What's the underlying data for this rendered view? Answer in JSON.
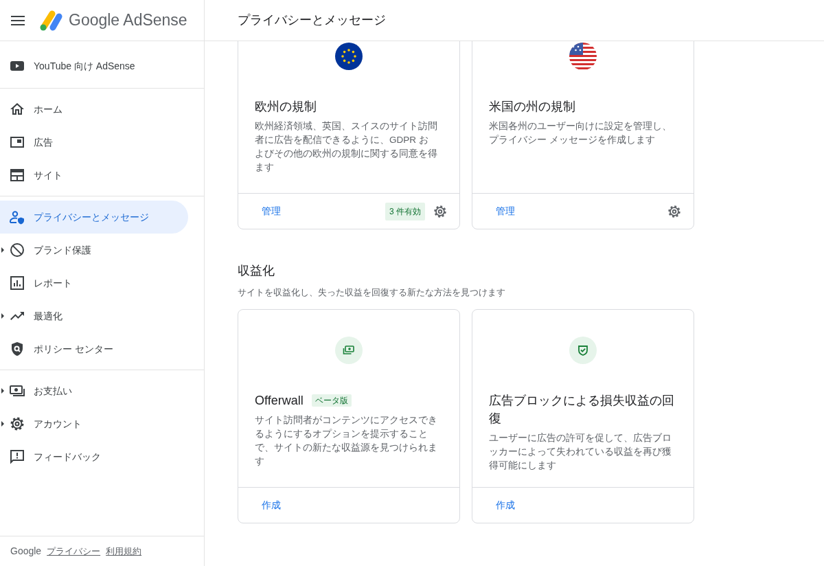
{
  "header": {
    "logo_text": "Google AdSense",
    "page_title": "プライバシーとメッセージ"
  },
  "sidebar": {
    "groups": [
      {
        "items": [
          {
            "label": "YouTube 向け AdSense",
            "selected": false,
            "expandable": false
          }
        ]
      },
      {
        "items": [
          {
            "label": "ホーム",
            "selected": false,
            "expandable": false
          },
          {
            "label": "広告",
            "selected": false,
            "expandable": false
          },
          {
            "label": "サイト",
            "selected": false,
            "expandable": false
          }
        ]
      },
      {
        "items": [
          {
            "label": "プライバシーとメッセージ",
            "selected": true,
            "expandable": false
          },
          {
            "label": "ブランド保護",
            "selected": false,
            "expandable": true
          },
          {
            "label": "レポート",
            "selected": false,
            "expandable": false
          },
          {
            "label": "最適化",
            "selected": false,
            "expandable": true
          },
          {
            "label": "ポリシー センター",
            "selected": false,
            "expandable": false
          }
        ]
      },
      {
        "items": [
          {
            "label": "お支払い",
            "selected": false,
            "expandable": true
          },
          {
            "label": "アカウント",
            "selected": false,
            "expandable": true
          },
          {
            "label": "フィードバック",
            "selected": false,
            "expandable": false
          }
        ]
      }
    ],
    "footer": {
      "brand": "Google",
      "links": [
        "プライバシー",
        "利用規約"
      ]
    }
  },
  "sections": [
    {
      "cards": [
        {
          "title": "欧州の規制",
          "description": "欧州経済領域、英国、スイスのサイト訪問者に広告を配信できるように、GDPR およびその他の欧州の規制に関する同意を得ます",
          "action": "管理",
          "status": "3 件有効",
          "settings": true
        },
        {
          "title": "米国の州の規制",
          "description": "米国各州のユーザー向けに設定を管理し、プライバシー メッセージを作成します",
          "action": "管理",
          "settings": true
        }
      ]
    },
    {
      "title": "収益化",
      "description": "サイトを収益化し、失った収益を回復する新たな方法を見つけます",
      "cards": [
        {
          "title": "Offerwall",
          "badge": "ベータ版",
          "description": "サイト訪問者がコンテンツにアクセスできるようにするオプションを提示することで、サイトの新たな収益源を見つけられます",
          "action": "作成",
          "settings": false
        },
        {
          "title": "広告ブロックによる損失収益の回復",
          "description": "ユーザーに広告の許可を促して、広告ブロッカーによって失われている収益を再び獲得可能にします",
          "action": "作成",
          "settings": false
        }
      ]
    }
  ]
}
